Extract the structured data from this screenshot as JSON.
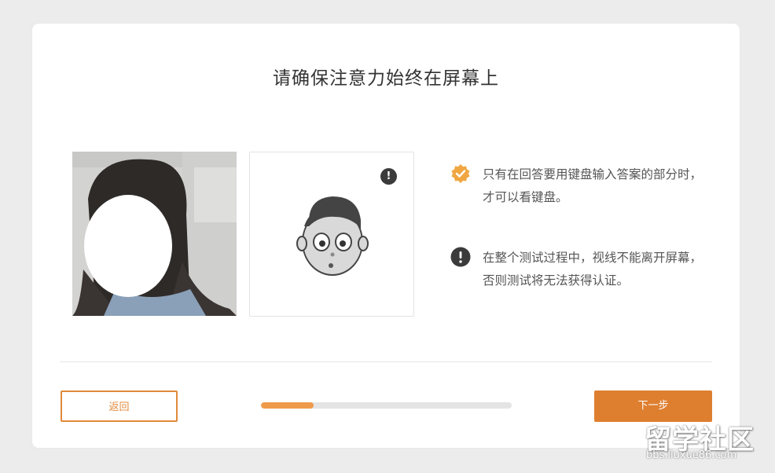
{
  "header": {
    "title": "请确保注意力始终在屏幕上"
  },
  "webcam": {
    "icon": "webcam-photo"
  },
  "illustration": {
    "icon": "face-looking-icon",
    "alert_icon": "exclamation-icon",
    "alert_symbol": "!"
  },
  "notes": [
    {
      "icon": "check-badge-icon",
      "color": "#f0a742",
      "text": "只有在回答要用键盘输入答案的部分时，才可以看键盘。"
    },
    {
      "icon": "exclamation-circle-icon",
      "color": "#3b3b3b",
      "text": "在整个测试过程中，视线不能离开屏幕，否则测试将无法获得认证。"
    }
  ],
  "footer": {
    "back_label": "返回",
    "next_label": "下一步",
    "progress_fraction": 0.21
  },
  "watermark": {
    "logo": "留学社区",
    "url": "bbs.liuxue86.com"
  },
  "colors": {
    "accent": "#de7f30",
    "progress": "#ef9a4b",
    "track": "#e4e4e4"
  }
}
